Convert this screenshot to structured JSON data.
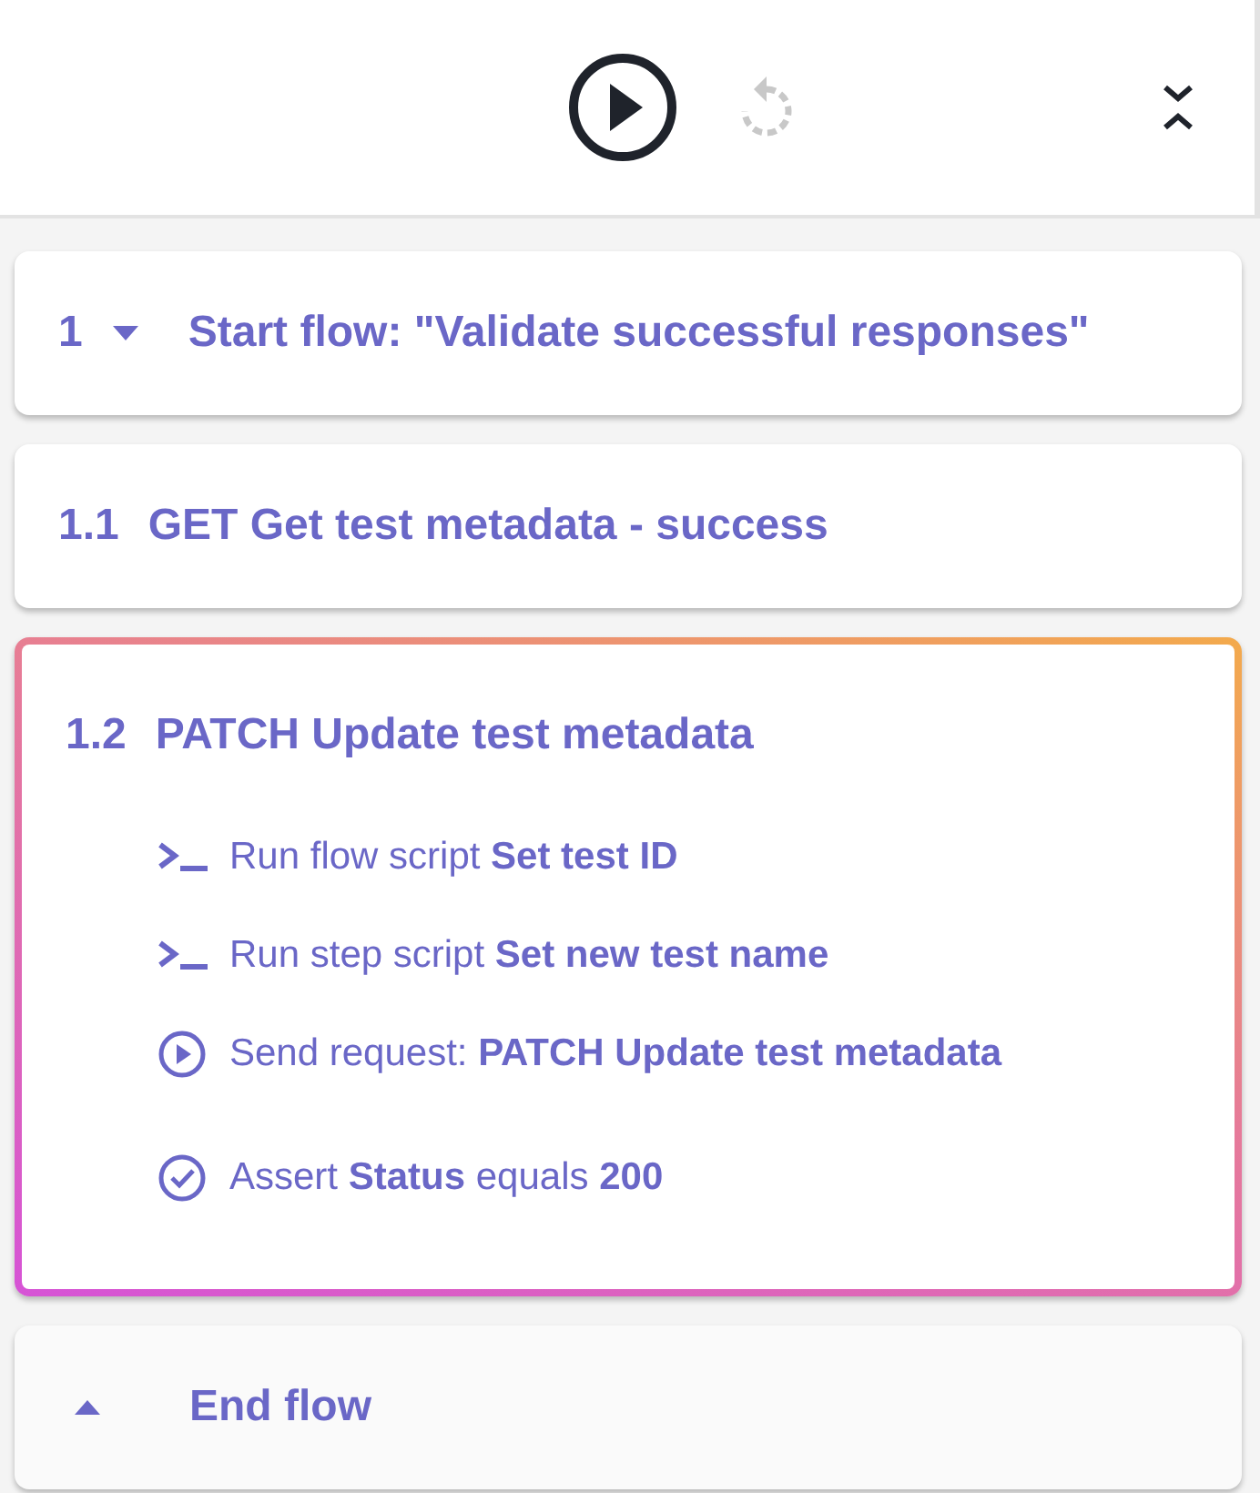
{
  "toolbar": {
    "run_disabled": false,
    "rerun_disabled": true
  },
  "cards": [
    {
      "kind": "start",
      "number": "1",
      "title": "Start flow: \"Validate successful responses\"",
      "highlighted": false
    },
    {
      "kind": "step",
      "number": "1.1",
      "title": "GET Get test metadata - success",
      "highlighted": false
    },
    {
      "kind": "step",
      "number": "1.2",
      "title": "PATCH Update test metadata",
      "highlighted": true,
      "actions": [
        {
          "kind": "script",
          "text": "Run flow script **Set test ID**"
        },
        {
          "kind": "script",
          "text": "Run step script **Set new test name**"
        },
        {
          "kind": "request",
          "text": "Send request: **PATCH Update test metadata**"
        },
        {
          "kind": "assert",
          "text": "Assert **Status** equals **200**"
        }
      ]
    },
    {
      "kind": "end",
      "title": "End flow",
      "highlighted": false
    }
  ]
}
